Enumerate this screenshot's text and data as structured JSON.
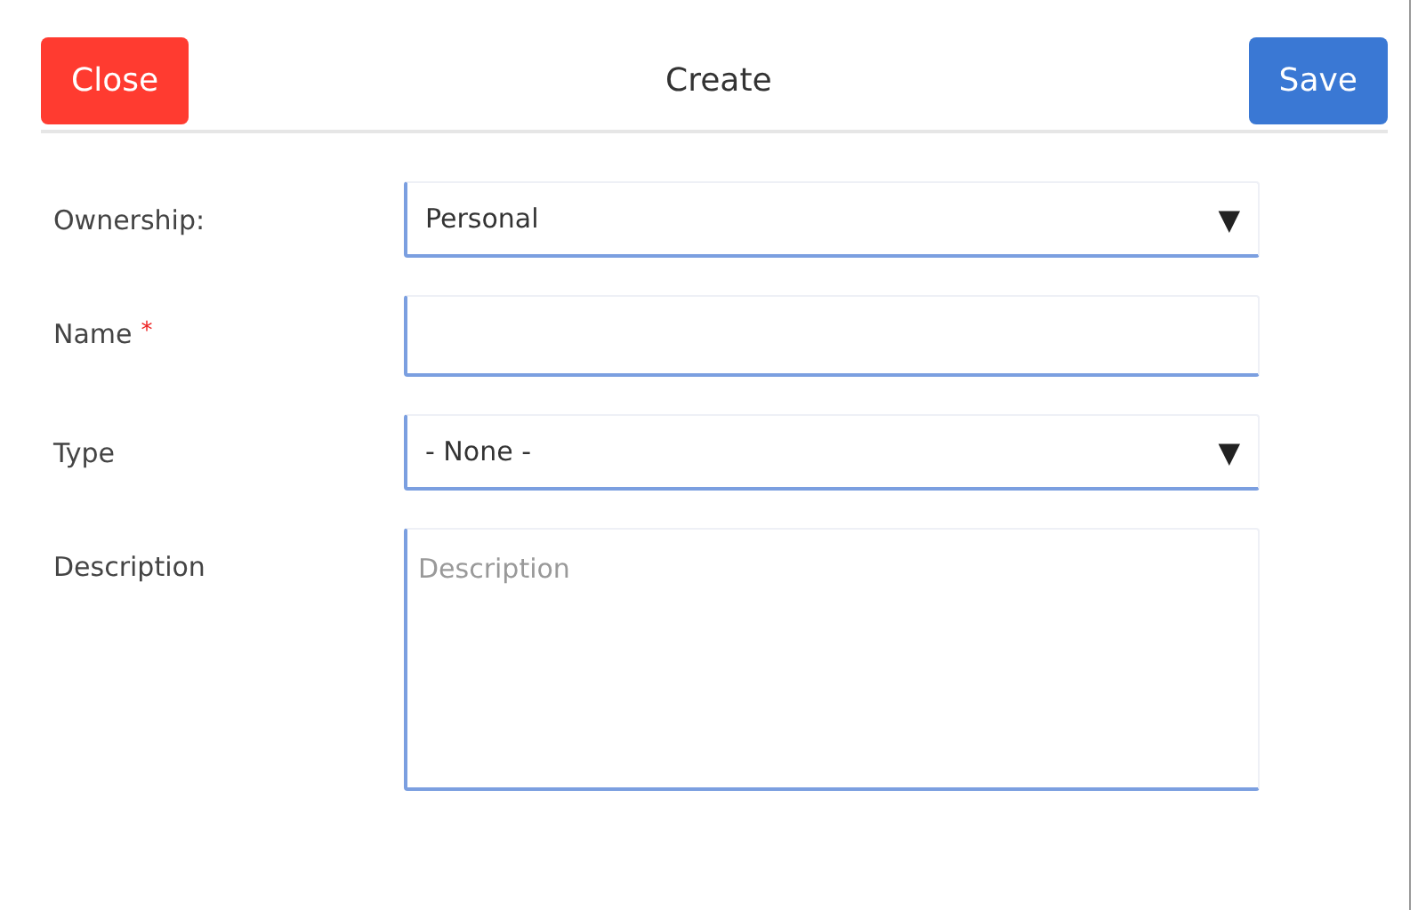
{
  "header": {
    "close_button": "Close",
    "title": "Create",
    "save_button": "Save"
  },
  "fields": [
    {
      "kind": "select",
      "label": "Ownership:",
      "value": "Personal",
      "caret": "▼"
    },
    {
      "kind": "text",
      "label": "Name",
      "required_mark": "*"
    },
    {
      "kind": "select",
      "label": "Type",
      "value": "- None -",
      "caret": "▼"
    },
    {
      "kind": "textarea",
      "label": "Description",
      "placeholder": "Description"
    }
  ]
}
